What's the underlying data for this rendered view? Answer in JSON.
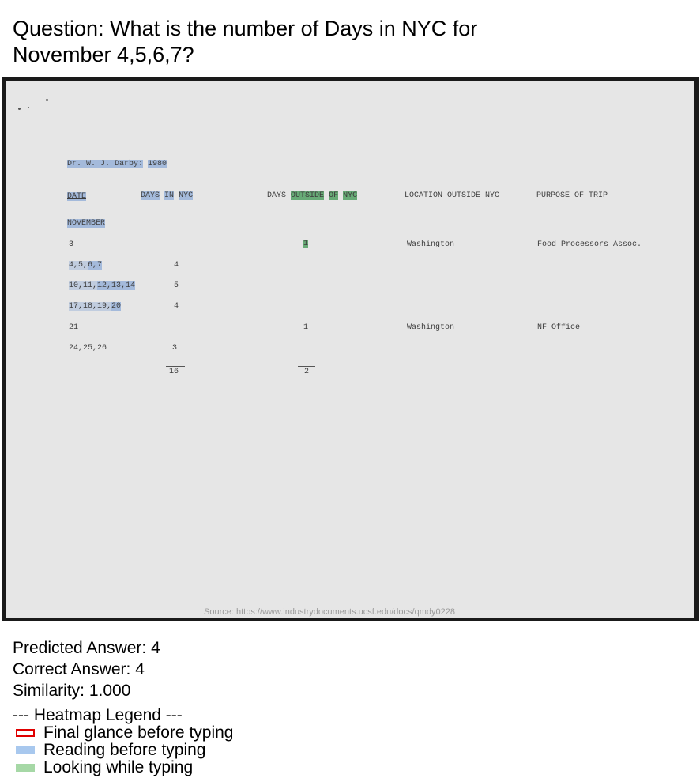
{
  "question": {
    "line1": "Question: What is the number of Days in NYC for",
    "line2": "November 4,5,6,7?"
  },
  "document": {
    "header": {
      "name": "Dr. W. J. Darby:",
      "year": "1980"
    },
    "columns": {
      "date": "DATE",
      "days_in_nyc_a": "DAYS",
      "days_in_nyc_b": "IN",
      "days_in_nyc_c": "NYC",
      "days_outside_a": "DAYS",
      "days_outside_b": "OUTSIDE",
      "days_outside_c": "OF",
      "days_outside_d": "NYC",
      "location": "LOCATION OUTSIDE NYC",
      "purpose": "PURPOSE OF TRIP"
    },
    "month": "NOVEMBER",
    "rows": [
      {
        "date": "3",
        "in_nyc": "",
        "outside": "1",
        "location": "Washington",
        "purpose": "Food Processors Assoc."
      },
      {
        "date_a": "4,5,",
        "date_b": "6,7",
        "in_nyc": "4"
      },
      {
        "date_a": "10,11,",
        "date_b": "12,13,14",
        "in_nyc": "5"
      },
      {
        "date_a": "17,18,19,",
        "date_b": "20",
        "in_nyc": "4"
      },
      {
        "date": "21",
        "in_nyc": "",
        "outside": "1",
        "location": "Washington",
        "purpose": "NF Office"
      },
      {
        "date": "24,25,26",
        "in_nyc": "3"
      }
    ],
    "totals": {
      "in_nyc": "16",
      "outside": "2"
    },
    "source": "Source: https://www.industrydocuments.ucsf.edu/docs/qmdy0228"
  },
  "results": {
    "predicted": "Predicted Answer: 4",
    "correct": "Correct Answer: 4",
    "similarity": "Similarity: 1.000"
  },
  "legend": {
    "title": "--- Heatmap Legend ---",
    "items": [
      {
        "label": "Final glance before typing",
        "color": "#e00000"
      },
      {
        "label": "Reading before typing",
        "color": "#a8c8ee"
      },
      {
        "label": "Looking while typing",
        "color": "#a6d8a6"
      }
    ]
  }
}
